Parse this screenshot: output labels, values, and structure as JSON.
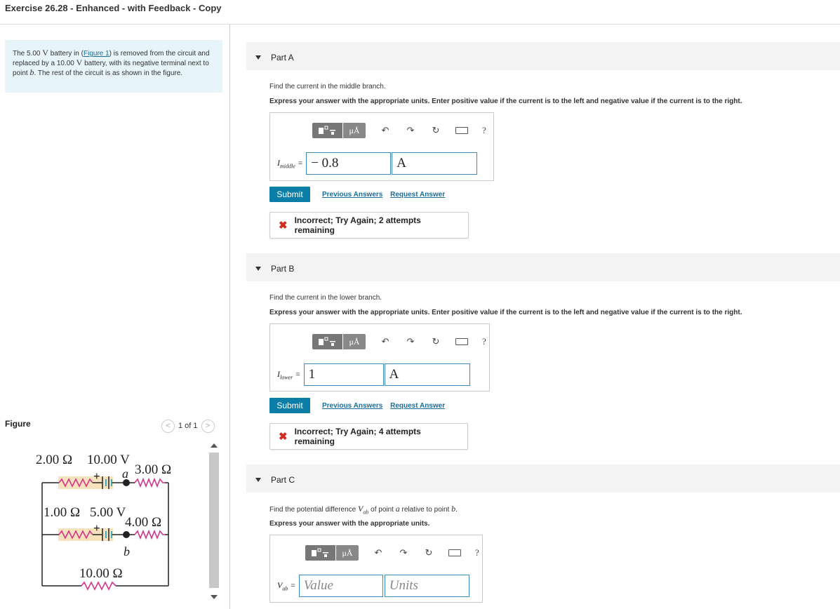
{
  "page": {
    "title": "Exercise 26.28 - Enhanced - with Feedback - Copy"
  },
  "problem": {
    "text_1": "The 5.00 ",
    "unit_v1": "V",
    "text_2": " battery in ",
    "figure_link": "Figure 1",
    "text_3": " is removed from the circuit and replaced by a 10.00 ",
    "unit_v2": "V",
    "text_4": " battery, with its negative terminal next to point ",
    "point_b": "b",
    "text_5": ". The rest of the circuit is as shown in the figure."
  },
  "figure": {
    "label": "Figure",
    "pager": "1 of 1",
    "prev": "<",
    "next": ">",
    "labels": {
      "r1": "2.00 Ω",
      "v1": "10.00 V",
      "a": "a",
      "r2": "3.00 Ω",
      "r3": "1.00 Ω",
      "v2": "5.00 V",
      "r4": "4.00 Ω",
      "b": "b",
      "r5": "10.00 Ω",
      "plus": "+"
    }
  },
  "toolbar": {
    "mu": "μÅ",
    "undo": "↶",
    "redo": "↷",
    "reset": "↻",
    "help": "?"
  },
  "partA": {
    "label": "Part A",
    "question": "Find the current in the middle branch.",
    "instruction": "Express your answer with the appropriate units. Enter positive value if the current is to the left and negative value if the current is to the right.",
    "var": "I",
    "var_sub": "middle",
    "eq": "=",
    "value": "− 0.8",
    "units": "A",
    "submit": "Submit",
    "previous_answers": "Previous Answers",
    "request_answer": "Request Answer",
    "feedback_mark": "✖",
    "feedback": "Incorrect; Try Again; 2 attempts remaining"
  },
  "partB": {
    "label": "Part B",
    "question": "Find the current in the lower branch.",
    "instruction": "Express your answer with the appropriate units. Enter positive value if the current is to the left and negative value if the current is to the right.",
    "var": "I",
    "var_sub": "lower",
    "eq": "=",
    "value": "1",
    "units": "A",
    "submit": "Submit",
    "previous_answers": "Previous Answers",
    "request_answer": "Request Answer",
    "feedback_mark": "✖",
    "feedback": "Incorrect; Try Again; 4 attempts remaining"
  },
  "partC": {
    "label": "Part C",
    "q_1": "Find the potential difference ",
    "q_var": "V",
    "q_var_sub": "ab",
    "q_2": " of point ",
    "q_a": "a",
    "q_3": " relative to point ",
    "q_b": "b",
    "q_4": ".",
    "instruction": "Express your answer with the appropriate units.",
    "var": "V",
    "var_sub": "ab",
    "eq": "=",
    "value_placeholder": "Value",
    "units_placeholder": "Units"
  },
  "colors": {
    "accent": "#0b7ea8",
    "resistor": "#d6338a",
    "highlight": "#f6e3bd",
    "error": "#d22a1e"
  }
}
